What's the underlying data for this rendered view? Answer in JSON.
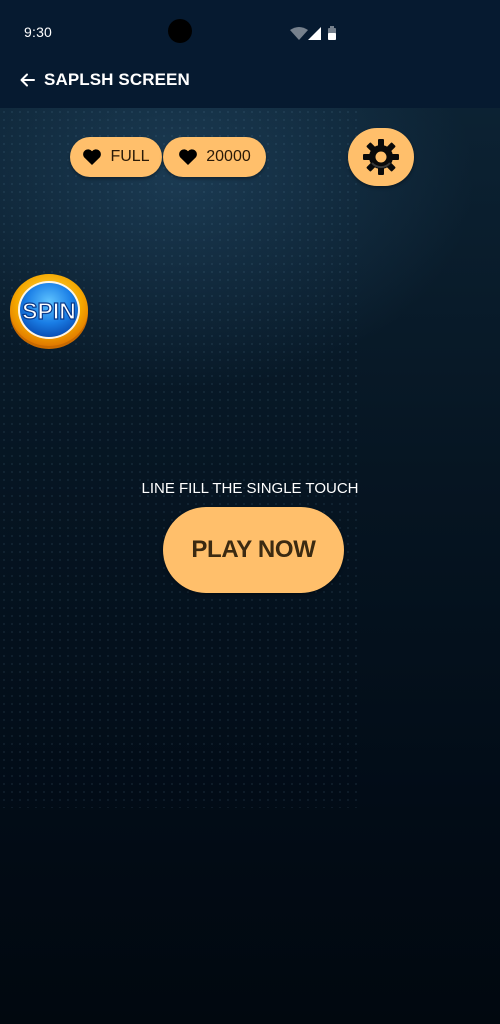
{
  "status_bar": {
    "time": "9:30"
  },
  "app_bar": {
    "title": "SAPLSH SCREEN"
  },
  "hud": {
    "lives_label": "FULL",
    "coins_value": "20000"
  },
  "spin": {
    "label": "SPIN"
  },
  "main": {
    "tagline": "LINE FILL THE SINGLE TOUCH",
    "play_label": "PLAY NOW"
  },
  "colors": {
    "accent": "#ffbf6b",
    "bar_background": "#061a30",
    "background": "#020c17"
  }
}
